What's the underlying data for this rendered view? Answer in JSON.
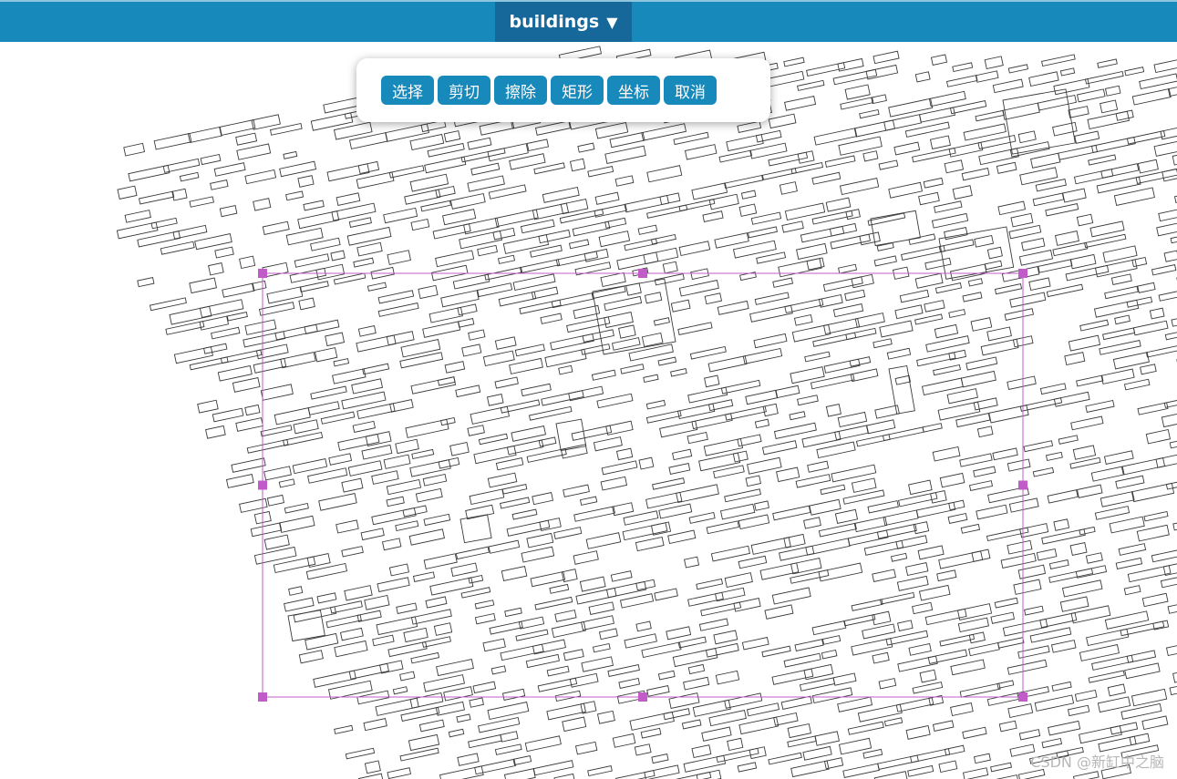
{
  "header": {
    "layer_label": "buildings",
    "dropdown_glyph": "▼"
  },
  "toolbar": {
    "buttons": [
      {
        "id": "select",
        "label": "选择"
      },
      {
        "id": "cut",
        "label": "剪切"
      },
      {
        "id": "erase",
        "label": "擦除"
      },
      {
        "id": "rectangle",
        "label": "矩形"
      },
      {
        "id": "coordinates",
        "label": "坐标"
      },
      {
        "id": "cancel",
        "label": "取消"
      }
    ]
  },
  "map": {
    "feature_type": "building footprints",
    "selection_color": "#c05bc8",
    "stroke_color": "#3a3a3a"
  },
  "watermark": "CSDN @新缸中之脑",
  "colors": {
    "accent": "#1789ba",
    "dropdown_bg": "#16679a"
  }
}
